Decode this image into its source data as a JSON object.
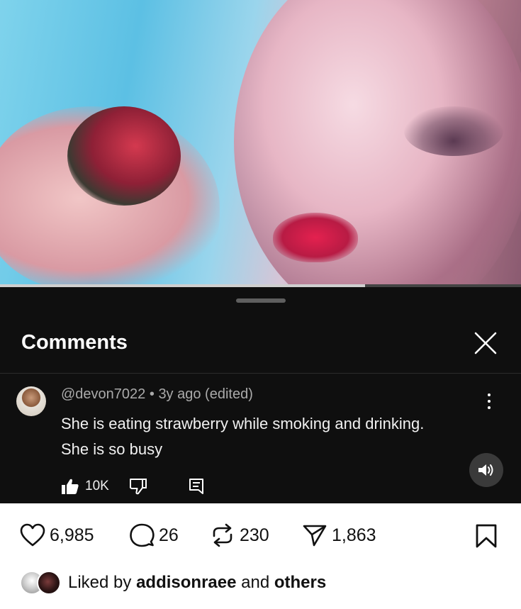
{
  "video": {
    "progress_fraction": 0.7
  },
  "comments": {
    "title": "Comments",
    "items": [
      {
        "handle": "@devon7022",
        "separator": "•",
        "age": "3y ago (edited)",
        "text": "She is eating strawberry while smoking and drinking. She is so busy",
        "like_count": "10K"
      }
    ]
  },
  "post": {
    "likes": "6,985",
    "comments": "26",
    "reposts": "230",
    "shares": "1,863",
    "liked_by": {
      "prefix": "Liked by",
      "user": "addisonraee",
      "connector": "and",
      "suffix": "others"
    }
  },
  "icons": {
    "close": "close-icon",
    "more": "more-vertical-icon",
    "like": "thumbs-up-icon",
    "dislike": "thumbs-down-icon",
    "reply": "reply-icon",
    "sound": "volume-icon",
    "heart": "heart-icon",
    "comment": "comment-icon",
    "repost": "repost-icon",
    "share": "send-icon",
    "bookmark": "bookmark-icon"
  },
  "colors": {
    "sheet_bg": "#0f0f0f",
    "meta_text": "#aaaaaa"
  }
}
